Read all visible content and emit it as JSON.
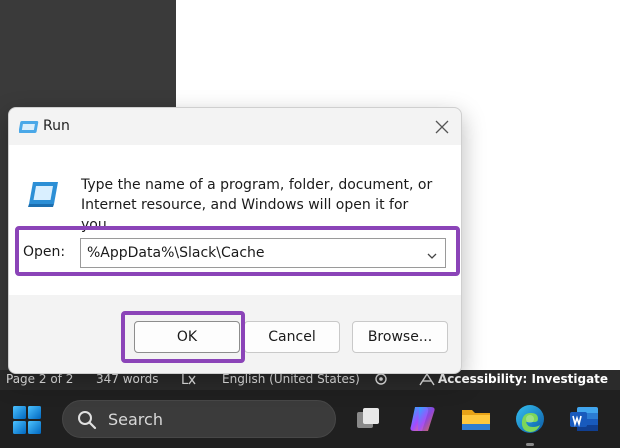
{
  "statusbar": {
    "page": "Page 2 of 2",
    "words": "347 words",
    "language": "English (United States)",
    "accessibility": "Accessibility: Investigate"
  },
  "taskbar": {
    "search_label": "Search",
    "apps": [
      "task-view-icon",
      "copilot-icon",
      "file-explorer-icon",
      "edge-icon",
      "word-icon"
    ]
  },
  "run_dialog": {
    "title": "Run",
    "description": "Type the name of a program, folder, document, or Internet resource, and Windows will open it for you.",
    "open_label": "Open:",
    "open_value": "%AppData%\\Slack\\Cache",
    "ok_label": "OK",
    "cancel_label": "Cancel",
    "browse_label": "Browse..."
  },
  "colors": {
    "highlight": "#8b44b8",
    "taskbar": "#202020",
    "windows_blue": "#0078d4"
  }
}
